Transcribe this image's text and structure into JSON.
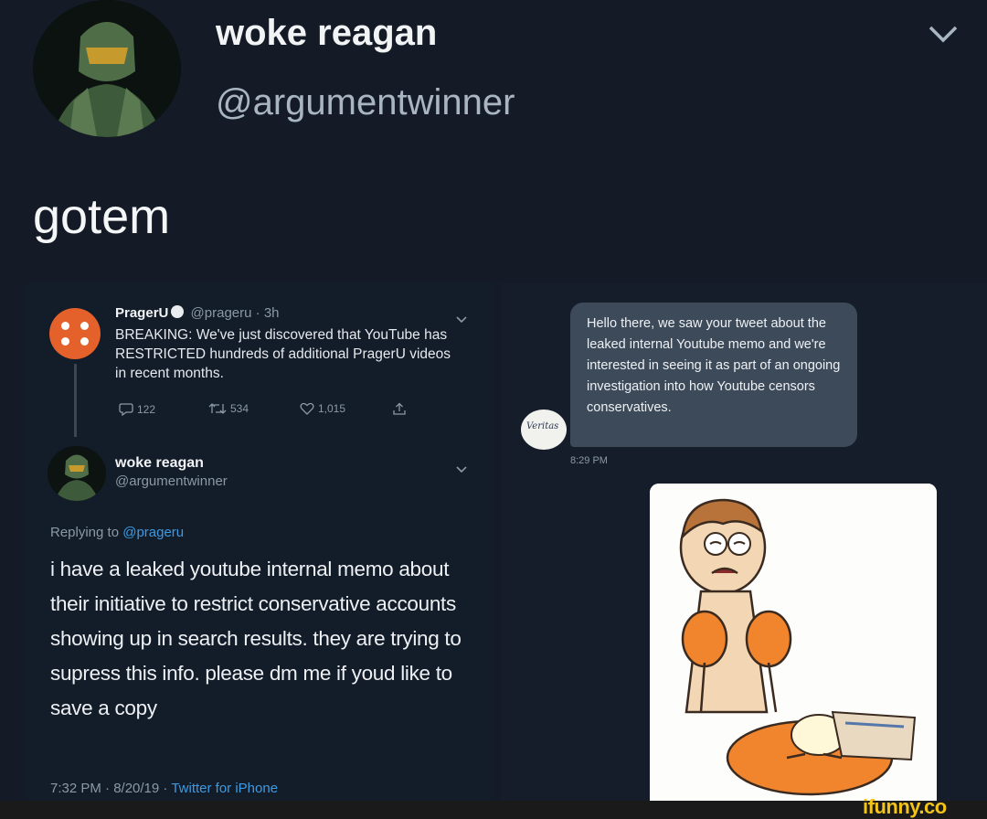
{
  "outer_tweet": {
    "author_name": "woke reagan",
    "author_handle": "@argumentwinner",
    "text": "gotem"
  },
  "quoted_tweet": {
    "author_name": "PragerU",
    "author_handle": "@prageru",
    "age": "3h",
    "text": "BREAKING: We've just discovered that YouTube has RESTRICTED hundreds of additional PragerU videos in recent months.",
    "replies": "122",
    "retweets": "534",
    "likes": "1,015"
  },
  "reply_tweet": {
    "author_name": "woke reagan",
    "author_handle": "@argumentwinner",
    "replying_prefix": "Replying to",
    "replying_handle": "@prageru",
    "text": "i have a leaked youtube internal memo about their initiative to restrict conservative accounts showing up in search results. they are trying to supress this info. please dm me if youd like to save a copy",
    "timestamp": "7:32 PM · 8/20/19 ·",
    "source": "Twitter for iPhone"
  },
  "dm": {
    "sender_avatar_text": "Veritas",
    "message": "Hello there, we saw your tweet about the leaked internal Youtube memo and we're interested in seeing it as part of an ongoing investigation into how Youtube censors conservatives.",
    "time": "8:29 PM"
  },
  "watermark": "ifunny.co",
  "colors": {
    "background": "#141b26",
    "link": "#3d9be3",
    "prageru_orange": "#e4612b",
    "watermark": "#f2c318"
  }
}
